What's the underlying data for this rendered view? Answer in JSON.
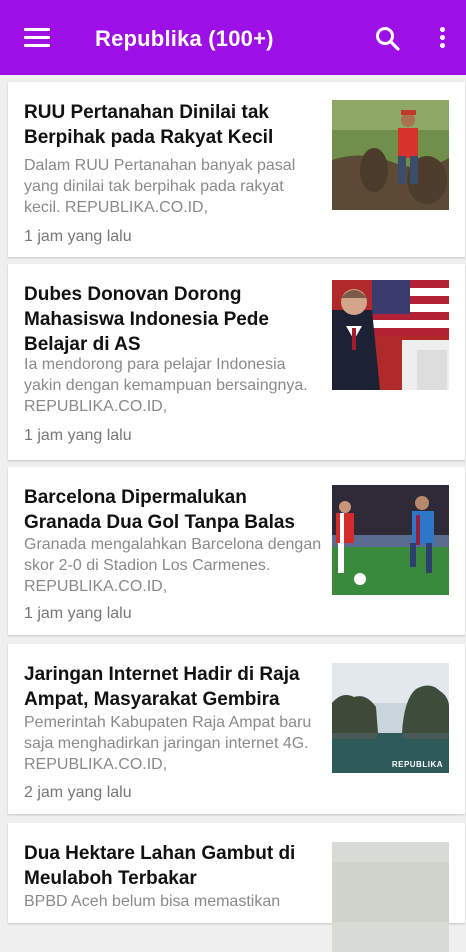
{
  "appbar": {
    "title": "Republika (100+)"
  },
  "articles": [
    {
      "headline": "RUU Pertanahan Dinilai tak Berpihak pada Rakyat Kecil",
      "snippet": "Dalam RUU Pertanahan banyak pasal yang dinilai tak berpihak pada rakyat kecil. REPUBLIKA.CO.ID,",
      "time": "1 jam yang lalu"
    },
    {
      "headline": "Dubes Donovan Dorong Mahasiswa Indonesia Pede Belajar di AS",
      "snippet": "Ia mendorong para pelajar Indonesia yakin dengan kemampuan bersaingnya. REPUBLIKA.CO.ID,",
      "time": "1 jam yang lalu"
    },
    {
      "headline": "Barcelona Dipermalukan Granada Dua Gol Tanpa Balas",
      "snippet": "Granada mengalahkan Barcelona dengan skor 2-0 di Stadion Los Carmenes. REPUBLIKA.CO.ID,",
      "time": "1 jam yang lalu"
    },
    {
      "headline": "Jaringan Internet Hadir di Raja Ampat, Masyarakat Gembira",
      "snippet": "Pemerintah Kabupaten Raja Ampat baru saja menghadirkan jaringan internet 4G. REPUBLIKA.CO.ID,",
      "time": "2 jam yang lalu",
      "watermark": "REPUBLIKA"
    },
    {
      "headline": "Dua Hektare Lahan Gambut di Meulaboh Terbakar",
      "snippet": "BPBD Aceh belum bisa memastikan",
      "time": ""
    }
  ]
}
